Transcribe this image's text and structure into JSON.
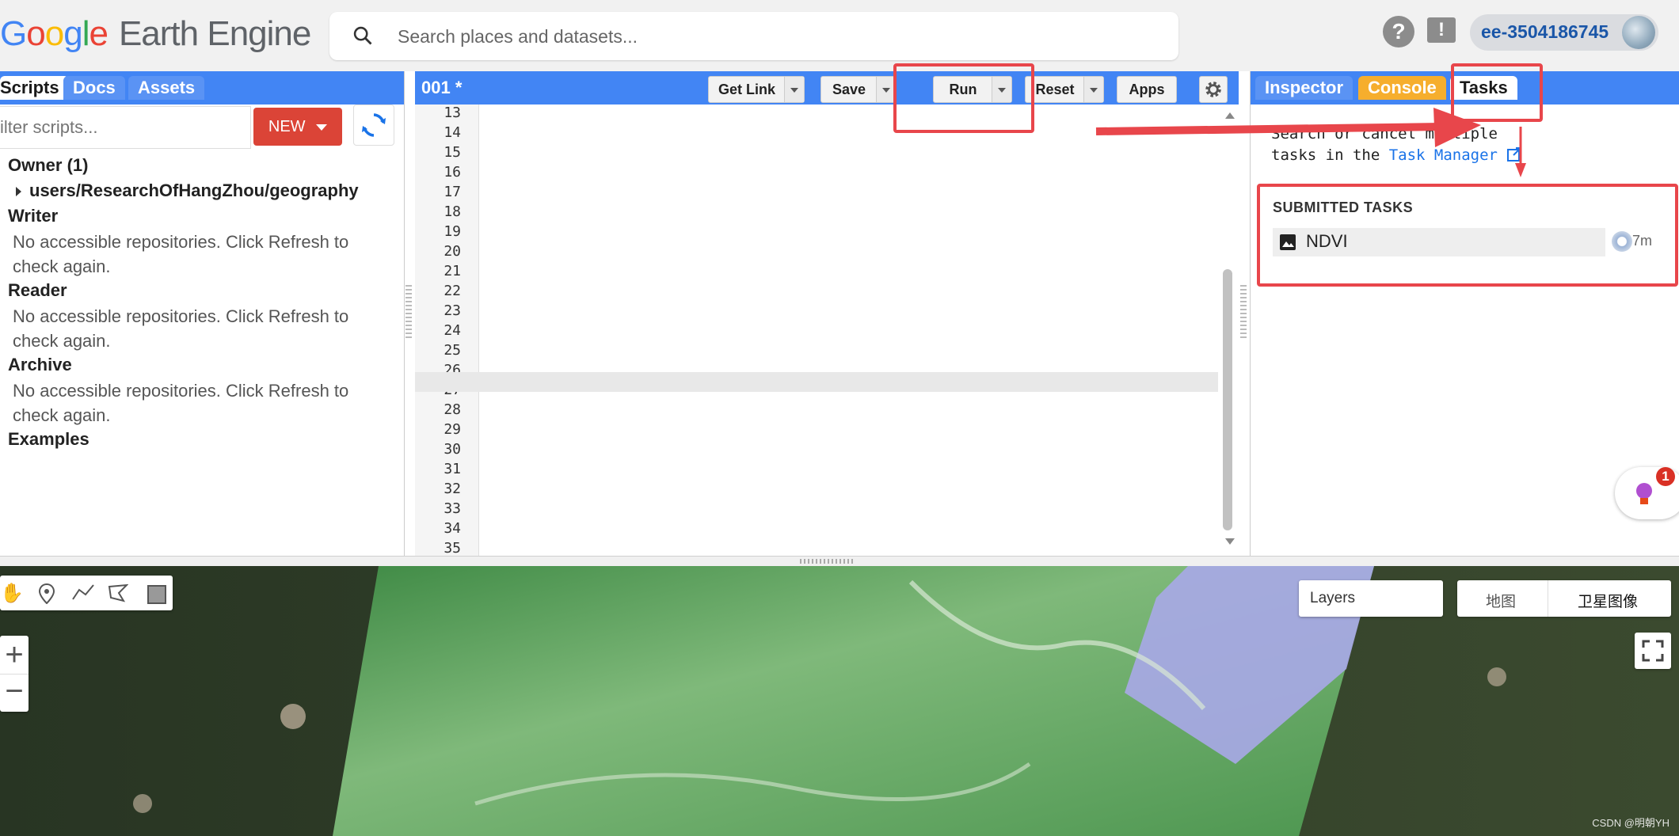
{
  "header": {
    "logo_letters": [
      "G",
      "o",
      "o",
      "g",
      "l",
      "e"
    ],
    "logo_rest": "Earth Engine",
    "search_placeholder": "Search places and datasets...",
    "help_icon": "?",
    "feedback_icon": "!",
    "username": "ee-3504186745"
  },
  "left_panel": {
    "tabs": [
      "Scripts",
      "Docs",
      "Assets"
    ],
    "filter_placeholder": "ilter scripts...",
    "new_button": "NEW",
    "tree": {
      "owner": "Owner (1)",
      "owner_repo": "users/ResearchOfHangZhou/geography",
      "writer": "Writer",
      "writer_msg": "No accessible repositories. Click Refresh to check again.",
      "reader": "Reader",
      "reader_msg": "No accessible repositories. Click Refresh to check again.",
      "archive": "Archive",
      "archive_msg": "No accessible repositories. Click Refresh to check again.",
      "examples": "Examples"
    }
  },
  "editor": {
    "title": "001 *",
    "buttons": {
      "get_link": "Get Link",
      "save": "Save",
      "run": "Run",
      "reset": "Reset",
      "apps": "Apps"
    },
    "line_numbers": [
      "13",
      "14",
      "15",
      "16",
      "17",
      "18",
      "19",
      "20",
      "21",
      "22",
      "23",
      "24",
      "25",
      "26",
      "27",
      "28",
      "29",
      "30",
      "31",
      "32",
      "33",
      "34",
      "35"
    ]
  },
  "right_panel": {
    "tabs": [
      "Inspector",
      "Console",
      "Tasks"
    ],
    "desc_line1": "Search or cancel multiple",
    "desc_line2_prefix": "tasks in the ",
    "task_manager_link": "Task Manager",
    "submitted_title": "SUBMITTED TASKS",
    "task_name": "NDVI",
    "task_time": "7m"
  },
  "map": {
    "layers_label": "Layers",
    "map_type_map": "地图",
    "map_type_satellite": "卫星图像",
    "zoom_in": "+",
    "zoom_out": "−",
    "watermark": "CSDN @明朝YH"
  },
  "badge_count": "1",
  "colors": {
    "accent_blue": "#4285f4",
    "new_red": "#db4437",
    "annotation_red": "#e8464b",
    "console_orange": "#f6ae2d"
  }
}
